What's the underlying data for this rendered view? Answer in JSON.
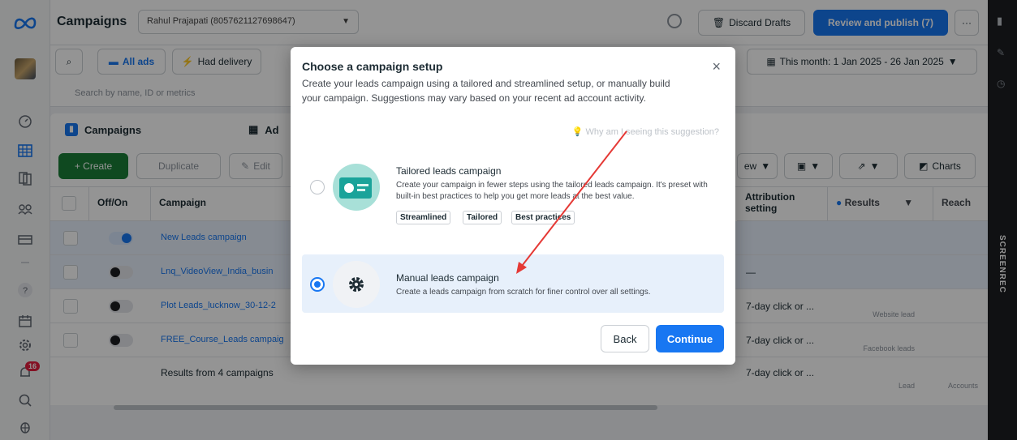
{
  "colors": {
    "accent": "#1877f2",
    "overlay": "rgba(0,0,0,0.42)"
  },
  "topbar": {
    "title": "Campaigns",
    "account": "Rahul Prajapati (8057621127698647)",
    "discard_label": "Discard Drafts",
    "review_label": "Review and publish (7)",
    "more_label": "···"
  },
  "filters": {
    "search_placeholder": "Search by name, ID or metrics",
    "all_ads_label": "All ads",
    "had_delivery_label": "Had delivery",
    "date_range": "This month: 1 Jan 2025 - 26 Jan 2025"
  },
  "tabs": {
    "campaigns": "Campaigns",
    "ads": "Ad"
  },
  "actions": {
    "create": "+ Create",
    "duplicate": "Duplicate",
    "edit": "Edit",
    "view_label": "ew",
    "charts": "Charts"
  },
  "table": {
    "headers": {
      "offon": "Off/On",
      "campaign": "Campaign",
      "attribution": "Attribution setting",
      "results": "Results",
      "reach": "Reach"
    },
    "rows": [
      {
        "name": "New Leads campaign",
        "attr": "",
        "res_sub": ""
      },
      {
        "name": "Lnq_VideoView_India_busin",
        "attr": "—",
        "res_sub": ""
      },
      {
        "name": "Plot Leads_lucknow_30-12-2",
        "attr": "7-day click or ...",
        "res_sub": "Website lead"
      },
      {
        "name": "FREE_Course_Leads campaig",
        "attr": "7-day click or ...",
        "res_sub": "Facebook leads"
      }
    ],
    "summary": "Results from 4 campaigns",
    "summary_attr": "7-day click or ...",
    "summary_res": "Lead",
    "summary_reach": "Accounts"
  },
  "rail": {
    "notification_count": "16"
  },
  "right_rail": {
    "brand": "SCREENREC"
  },
  "modal": {
    "title": "Choose a campaign setup",
    "description": "Create your leads campaign using a tailored and streamlined setup, or manually build your campaign. Suggestions may vary based on your recent ad account activity.",
    "why_link": "Why am I seeing this suggestion?",
    "options": [
      {
        "title": "Tailored leads campaign",
        "description": "Create your campaign in fewer steps using the tailored leads campaign. It's preset with built-in best practices to help you get more leads at the best value.",
        "tags": [
          "Streamlined",
          "Tailored",
          "Best practices"
        ],
        "selected": false
      },
      {
        "title": "Manual leads campaign",
        "description": "Create a leads campaign from scratch for finer control over all settings.",
        "selected": true
      }
    ],
    "back_label": "Back",
    "continue_label": "Continue"
  }
}
